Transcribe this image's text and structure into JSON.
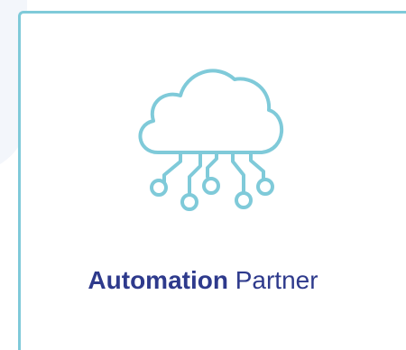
{
  "card": {
    "icon": "cloud-network-icon",
    "title_bold": "Automation",
    "title_regular": "Partner"
  },
  "colors": {
    "accent": "#7fcad9",
    "title": "#2e3a8c",
    "background": "#ffffff"
  }
}
